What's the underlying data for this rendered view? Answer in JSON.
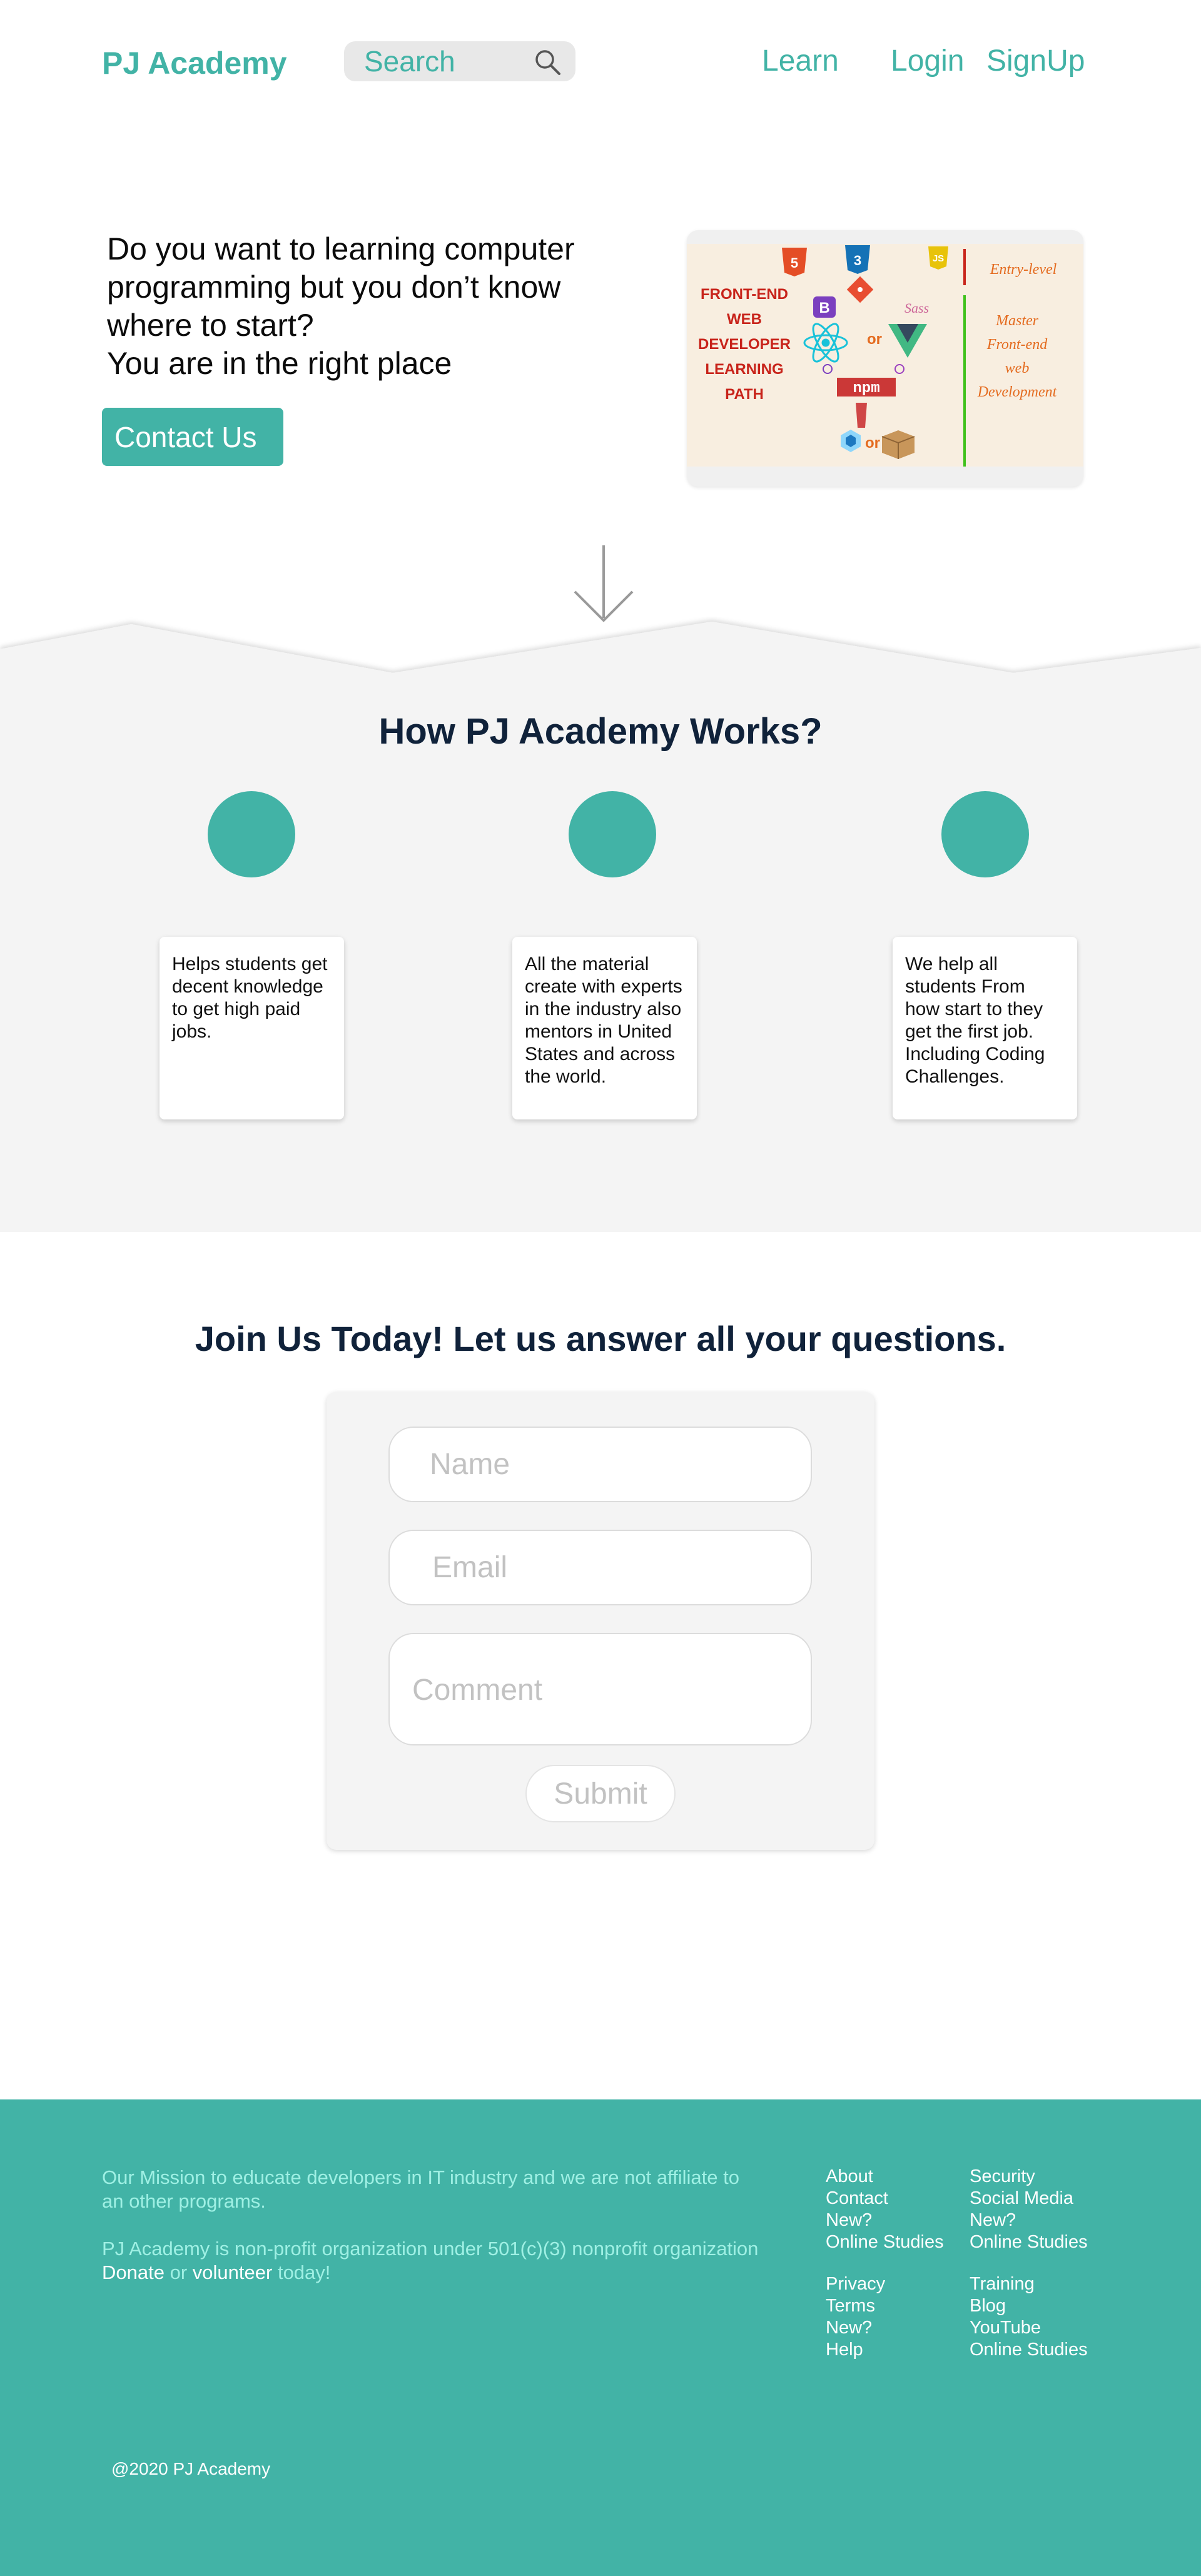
{
  "header": {
    "logo": "PJ Academy",
    "search_placeholder": "Search",
    "nav": {
      "learn": "Learn",
      "login": "Login",
      "signup": "SignUp"
    }
  },
  "hero": {
    "question": "Do you want to learning computer programming but you don’t know where to start?",
    "tagline": "You are in the right place",
    "cta_label": "Contact Us",
    "image": {
      "path_title": [
        "FRONT-END",
        "WEB",
        "DEVELOPER",
        "LEARNING",
        "PATH"
      ],
      "level_entry": "Entry-level",
      "level_master": [
        "Master",
        "Front-end",
        "web",
        "Development"
      ],
      "or_label": "or",
      "npm_label": "npm",
      "sass_label": "Sass",
      "icons": [
        "html5-icon",
        "css3-icon",
        "js-icon",
        "bootstrap-icon",
        "git-icon",
        "sass-icon",
        "react-icon",
        "vue-icon",
        "npm-icon",
        "webpack-icon",
        "package-box-icon"
      ]
    }
  },
  "how_it_works": {
    "title": "How PJ Academy Works?",
    "steps": [
      {
        "text": "Helps students get decent knowledge to get high paid jobs."
      },
      {
        "text": "All the material create with experts in the industry also mentors in United States and across the world."
      },
      {
        "text": "We help all students From how start to they get the first job. Including Coding Challenges."
      }
    ]
  },
  "contact": {
    "title": "Join Us Today! Let us answer all your questions.",
    "name_placeholder": "Name",
    "email_placeholder": "Email",
    "comment_placeholder": "Comment",
    "submit_label": "Submit"
  },
  "footer": {
    "mission": "Our Mission to educate developers in IT industry and we are not affiliate to an other programs.",
    "nonprofit_prefix": "PJ Academy is non-profit organization under 501(c)(3) nonprofit organization",
    "donate": "Donate",
    "or": "or",
    "volunteer": "volunteer",
    "today": "today!",
    "links": {
      "col1a": [
        "About",
        "Contact",
        "New?",
        "Online Studies"
      ],
      "col2a": [
        "Security",
        "Social Media",
        "New?",
        "Online Studies"
      ],
      "col1b": [
        "Privacy",
        "Terms",
        "New?",
        "Help"
      ],
      "col2b": [
        "Training",
        "Blog",
        "YouTube",
        "Online Studies"
      ]
    },
    "copyright": "@2020 PJ Academy"
  },
  "colors": {
    "accent": "#42b3a6",
    "section_bg": "#f4f4f4",
    "mission_text": "#9ff0e4"
  }
}
